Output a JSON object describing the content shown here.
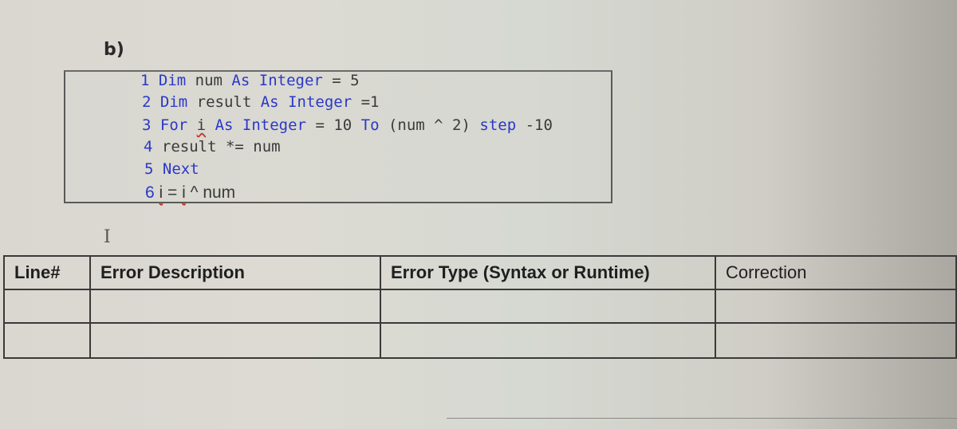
{
  "section_label": "b)",
  "code": {
    "lines": [
      {
        "num": "1",
        "tokens": [
          {
            "t": "Dim",
            "k": "kw"
          },
          {
            "t": " num ",
            "k": "plain"
          },
          {
            "t": "As",
            "k": "kw"
          },
          {
            "t": " ",
            "k": "plain"
          },
          {
            "t": "Integer",
            "k": "kw"
          },
          {
            "t": " = 5",
            "k": "plain"
          }
        ]
      },
      {
        "num": "2",
        "tokens": [
          {
            "t": "Dim",
            "k": "kw"
          },
          {
            "t": " result ",
            "k": "plain"
          },
          {
            "t": "As",
            "k": "kw"
          },
          {
            "t": " ",
            "k": "plain"
          },
          {
            "t": "Integer",
            "k": "kw"
          },
          {
            "t": " =1",
            "k": "plain"
          }
        ]
      },
      {
        "num": "3",
        "tokens": [
          {
            "t": "For",
            "k": "kw"
          },
          {
            "t": " ",
            "k": "plain"
          },
          {
            "t": "i",
            "k": "squig"
          },
          {
            "t": " ",
            "k": "plain"
          },
          {
            "t": "As",
            "k": "kw"
          },
          {
            "t": " ",
            "k": "plain"
          },
          {
            "t": "Integer",
            "k": "kw"
          },
          {
            "t": " = 10 ",
            "k": "plain"
          },
          {
            "t": "To",
            "k": "kw"
          },
          {
            "t": " (num ^ 2) ",
            "k": "plain"
          },
          {
            "t": "step",
            "k": "kw"
          },
          {
            "t": " -10",
            "k": "plain"
          }
        ]
      },
      {
        "num": "4",
        "tokens": [
          {
            "t": "result *= num",
            "k": "plain"
          }
        ]
      },
      {
        "num": "5",
        "tokens": [
          {
            "t": "Next",
            "k": "kw"
          }
        ]
      },
      {
        "num": "6",
        "tokens": [
          {
            "t": "i",
            "k": "squig"
          },
          {
            "t": " = ",
            "k": "plain"
          },
          {
            "t": "i",
            "k": "squig"
          },
          {
            "t": " ^ num",
            "k": "plain"
          }
        ]
      }
    ]
  },
  "cursor_glyph": "I",
  "table": {
    "headers": [
      "Line#",
      "Error Description",
      "Error Type (Syntax or Runtime)",
      "Correction"
    ],
    "rows": [
      [
        "",
        "",
        "",
        ""
      ],
      [
        "",
        "",
        "",
        ""
      ]
    ]
  },
  "colors": {
    "keyword": "#2a38c8",
    "text": "#3a3a3a",
    "squiggle": "#c0392b"
  }
}
